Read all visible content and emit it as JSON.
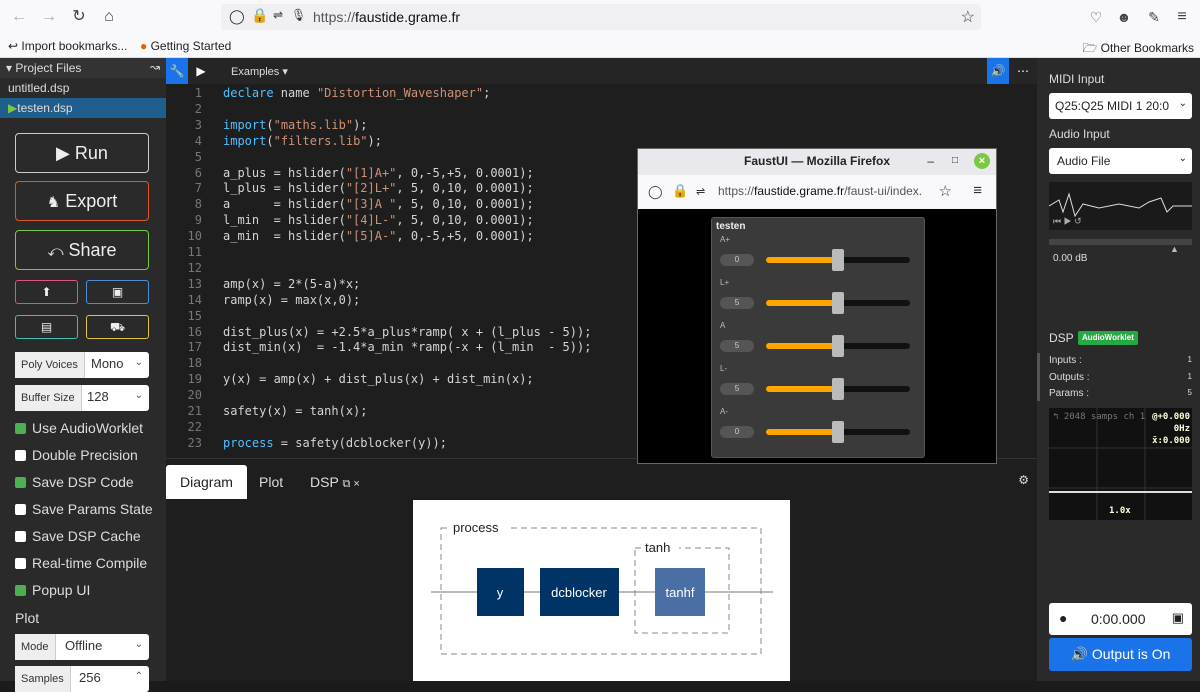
{
  "browser": {
    "url_prefix": "https://",
    "url_host": "faustide.grame.fr",
    "bookmarks": [
      {
        "label": "Import bookmarks..."
      },
      {
        "label": "Getting Started"
      }
    ],
    "other_bookmarks": "Other Bookmarks"
  },
  "left_panel": {
    "header": "Project Files",
    "files": [
      "untitled.dsp",
      "testen.dsp"
    ],
    "active_file": "testen.dsp",
    "run": "Run",
    "export": "Export",
    "share": "Share",
    "poly_voices": {
      "label": "Poly Voices",
      "value": "Mono"
    },
    "buffer_size": {
      "label": "Buffer Size",
      "value": "128"
    },
    "options": [
      {
        "label": "Use AudioWorklet",
        "checked": true
      },
      {
        "label": "Double Precision",
        "checked": false
      },
      {
        "label": "Save DSP Code",
        "checked": true
      },
      {
        "label": "Save Params State",
        "checked": false
      },
      {
        "label": "Save DSP Cache",
        "checked": false
      },
      {
        "label": "Real-time Compile",
        "checked": false
      },
      {
        "label": "Popup UI",
        "checked": true
      }
    ],
    "plot_header": "Plot",
    "mode": {
      "label": "Mode",
      "value": "Offline"
    },
    "samples": {
      "label": "Samples",
      "value": "256"
    }
  },
  "editor": {
    "examples": "Examples",
    "lines": [
      "declare name \"Distortion_Waveshaper\";",
      "",
      "import(\"maths.lib\");",
      "import(\"filters.lib\");",
      "",
      "a_plus = hslider(\"[1]A+\", 0,-5,+5, 0.0001);",
      "l_plus = hslider(\"[2]L+\", 5, 0,10, 0.0001);",
      "a      = hslider(\"[3]A \", 5, 0,10, 0.0001);",
      "l_min  = hslider(\"[4]L-\", 5, 0,10, 0.0001);",
      "a_min  = hslider(\"[5]A-\", 0,-5,+5, 0.0001);",
      "",
      "",
      "amp(x) = 2*(5-a)*x;",
      "ramp(x) = max(x,0);",
      "",
      "dist_plus(x) = +2.5*a_plus*ramp( x + (l_plus - 5));",
      "dist_min(x)  = -1.4*a_min *ramp(-x + (l_min  - 5));",
      "",
      "y(x) = amp(x) + dist_plus(x) + dist_min(x);",
      "",
      "safety(x) = tanh(x);",
      "",
      "process = safety(dcblocker(y));"
    ]
  },
  "tabs": {
    "diagram": "Diagram",
    "plot": "Plot",
    "dsp": "DSP"
  },
  "diagram": {
    "process": "process",
    "y": "y",
    "dcblocker": "dcblocker",
    "tanh": "tanh",
    "tanhf": "tanhf"
  },
  "popup": {
    "title": "FaustUI — Mozilla Firefox",
    "url_prefix": "https://",
    "url_host": "faustide.grame.fr",
    "url_path": "/faust-ui/index.",
    "panel_title": "testen",
    "sliders": [
      {
        "label": "A+",
        "value": "0",
        "level": 0.5
      },
      {
        "label": "L+",
        "value": "5",
        "level": 0.5
      },
      {
        "label": "A",
        "value": "5",
        "level": 0.5
      },
      {
        "label": "L-",
        "value": "5",
        "level": 0.5
      },
      {
        "label": "A-",
        "value": "0",
        "level": 0.5
      }
    ]
  },
  "right_panel": {
    "midi_input": "MIDI Input",
    "midi_device": "Q25:Q25 MIDI 1 20:0",
    "audio_input": "Audio Input",
    "audio_source": "Audio File",
    "gain": "0.00 dB",
    "dsp": "DSP",
    "dsp_badge": "AudioWorklet",
    "inputs": {
      "label": "Inputs :",
      "value": "1"
    },
    "outputs": {
      "label": "Outputs :",
      "value": "1"
    },
    "params": {
      "label": "Params :",
      "value": "5"
    },
    "scope": {
      "samps": "2048 samps",
      "ch": "ch 1",
      "val1": "@+0.000",
      "val2": "0Hz",
      "val3": "x̄:0.000",
      "zoom": "1.0x"
    },
    "time": "0:00.000",
    "output": "Output is On"
  },
  "colors": {
    "run_border": "#cccccc",
    "export_border": "#e0562b",
    "share_border": "#7ac943",
    "accent_blue": "#1a73e8",
    "slider_fill": "#ffa500"
  }
}
